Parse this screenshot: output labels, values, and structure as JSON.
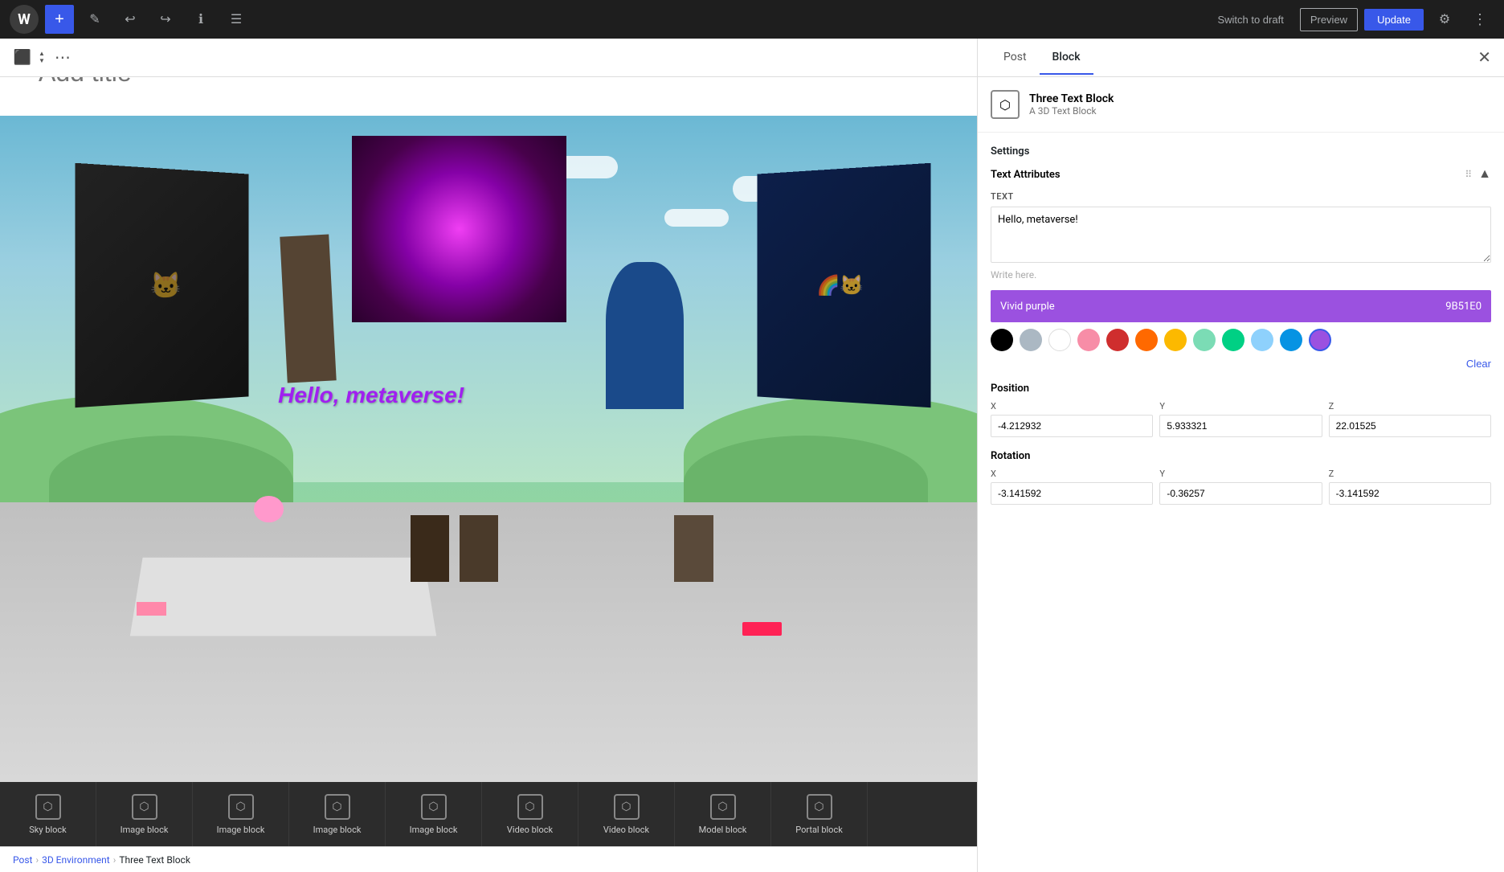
{
  "toolbar": {
    "logo_label": "W",
    "add_label": "+",
    "edit_label": "✎",
    "undo_label": "↩",
    "redo_label": "↪",
    "info_label": "ℹ",
    "list_label": "☰",
    "switch_draft": "Switch to draft",
    "preview": "Preview",
    "update": "Update",
    "settings_label": "⚙",
    "more_label": "⋮"
  },
  "second_bar": {
    "cube_label": "⬛",
    "more_dots": "⋯"
  },
  "title": {
    "placeholder": "Add title"
  },
  "scene": {
    "hello_text": "Hello, metaverse!"
  },
  "block_bar": {
    "items": [
      {
        "label": "Sky block",
        "icon": "⬡"
      },
      {
        "label": "Image block",
        "icon": "⬡"
      },
      {
        "label": "Image block",
        "icon": "⬡"
      },
      {
        "label": "Image block",
        "icon": "⬡"
      },
      {
        "label": "Image block",
        "icon": "⬡"
      },
      {
        "label": "Video block",
        "icon": "⬡"
      },
      {
        "label": "Video block",
        "icon": "⬡"
      },
      {
        "label": "Model block",
        "icon": "⬡"
      },
      {
        "label": "Portal block",
        "icon": "⬡"
      }
    ]
  },
  "right_panel": {
    "tab_post": "Post",
    "tab_block": "Block",
    "block_name": "Three Text Block",
    "block_sub": "A 3D Text Block",
    "settings_label": "Settings",
    "text_attributes_label": "Text Attributes",
    "text_field_label": "TEXT",
    "text_value": "Hello, metaverse!",
    "text_placeholder": "Write here.",
    "color_name": "Vivid purple",
    "color_hex": "9B51E0",
    "colors": [
      {
        "name": "black",
        "hex": "#000000",
        "selected": false
      },
      {
        "name": "gray",
        "hex": "#abb8c3",
        "selected": false
      },
      {
        "name": "white",
        "hex": "#ffffff",
        "selected": false
      },
      {
        "name": "pale-pink",
        "hex": "#f78da7",
        "selected": false
      },
      {
        "name": "vivid-red",
        "hex": "#cf2e2e",
        "selected": false
      },
      {
        "name": "luminous-orange",
        "hex": "#ff6900",
        "selected": false
      },
      {
        "name": "luminous-yellow",
        "hex": "#fcb900",
        "selected": false
      },
      {
        "name": "light-green",
        "hex": "#7bdcb5",
        "selected": false
      },
      {
        "name": "vivid-green",
        "hex": "#00d084",
        "selected": false
      },
      {
        "name": "pale-blue",
        "hex": "#8ed1fc",
        "selected": false
      },
      {
        "name": "vivid-blue",
        "hex": "#0693e3",
        "selected": false
      },
      {
        "name": "vivid-purple",
        "hex": "#9b51e0",
        "selected": true
      }
    ],
    "clear_label": "Clear",
    "position_label": "Position",
    "pos_x_label": "X",
    "pos_y_label": "Y",
    "pos_z_label": "Z",
    "pos_x_value": "-4.212932",
    "pos_y_value": "5.933321",
    "pos_z_value": "22.01525",
    "rotation_label": "Rotation",
    "rot_x_label": "X",
    "rot_y_label": "Y",
    "rot_z_label": "Z",
    "rot_x_value": "-3.141592",
    "rot_y_value": "-0.36257",
    "rot_z_value": "-3.141592"
  },
  "breadcrumb": {
    "post": "Post",
    "env": "3D Environment",
    "current": "Three Text Block"
  }
}
